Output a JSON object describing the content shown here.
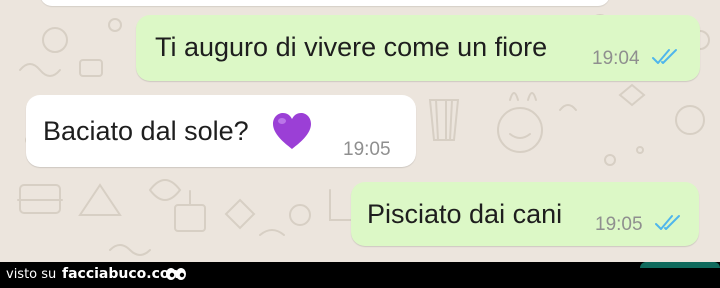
{
  "chat": {
    "messages": [
      {
        "direction": "outgoing",
        "text": "Ti auguro di vivere come un fiore",
        "time": "19:04",
        "status": "read-double-check"
      },
      {
        "direction": "incoming",
        "text": "Baciato dal sole?",
        "emoji": "purple-heart",
        "time": "19:05"
      },
      {
        "direction": "outgoing",
        "text": "Pisciato dai cani",
        "time": "19:05",
        "status": "read-double-check"
      }
    ]
  },
  "footer": {
    "prefix": "visto su",
    "site": "facciabuco.com",
    "logo_icon": "eyes-icon"
  },
  "colors": {
    "chat_background": "#ECE5DD",
    "outgoing_bubble": "#DCF8C6",
    "incoming_bubble": "#FFFFFF",
    "read_ticks": "#4FB6EC",
    "heart": "#9B3FD6",
    "footer_background": "#000000"
  }
}
